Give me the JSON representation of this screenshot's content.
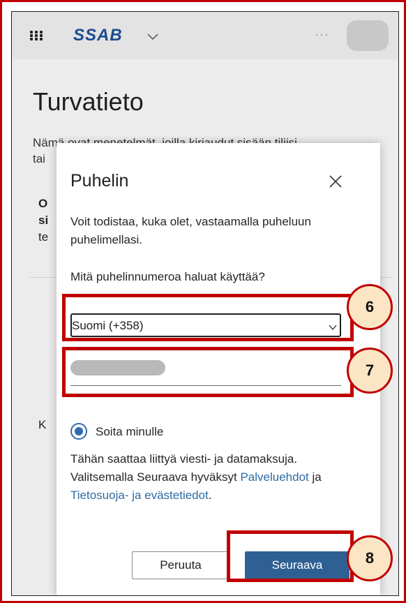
{
  "header": {
    "brand": "SSAB",
    "more": "···",
    "icons": {
      "apps": "apps-grid-icon",
      "brand_menu": "chevron-down-icon",
      "avatar": "avatar"
    }
  },
  "background": {
    "title": "Turvatieto",
    "description_line1": "Nämä ovat menetelmät, joilla kirjaudut sisään tiliisi",
    "description_line2": "tai",
    "fragment_o": "O",
    "fragment_si": "si",
    "fragment_te": "te",
    "fragment_ka": "K"
  },
  "dialog": {
    "title": "Puhelin",
    "intro": "Voit todistaa, kuka olet, vastaamalla puheluun puhelimellasi.",
    "question": "Mitä puhelinnumeroa haluat käyttää?",
    "country_value": "Suomi (+358)",
    "radio_label": "Soita minulle",
    "fine_print_pre": "Tähän saattaa liittyä viesti- ja datamaksuja. Valitsemalla Seuraava hyväksyt ",
    "terms_link": "Palveluehdot",
    "fine_print_mid": " ja ",
    "privacy_link": "Tietosuoja- ja evästetiedot",
    "fine_print_post": ".",
    "cancel_label": "Peruuta",
    "next_label": "Seuraava"
  },
  "annotations": {
    "step6": "6",
    "step7": "7",
    "step8": "8"
  },
  "colors": {
    "highlight": "#c00000",
    "marker_fill": "#fbe5c4",
    "primary_button": "#2f6093",
    "link": "#2d6ca2",
    "radio": "#2f6bb0"
  }
}
